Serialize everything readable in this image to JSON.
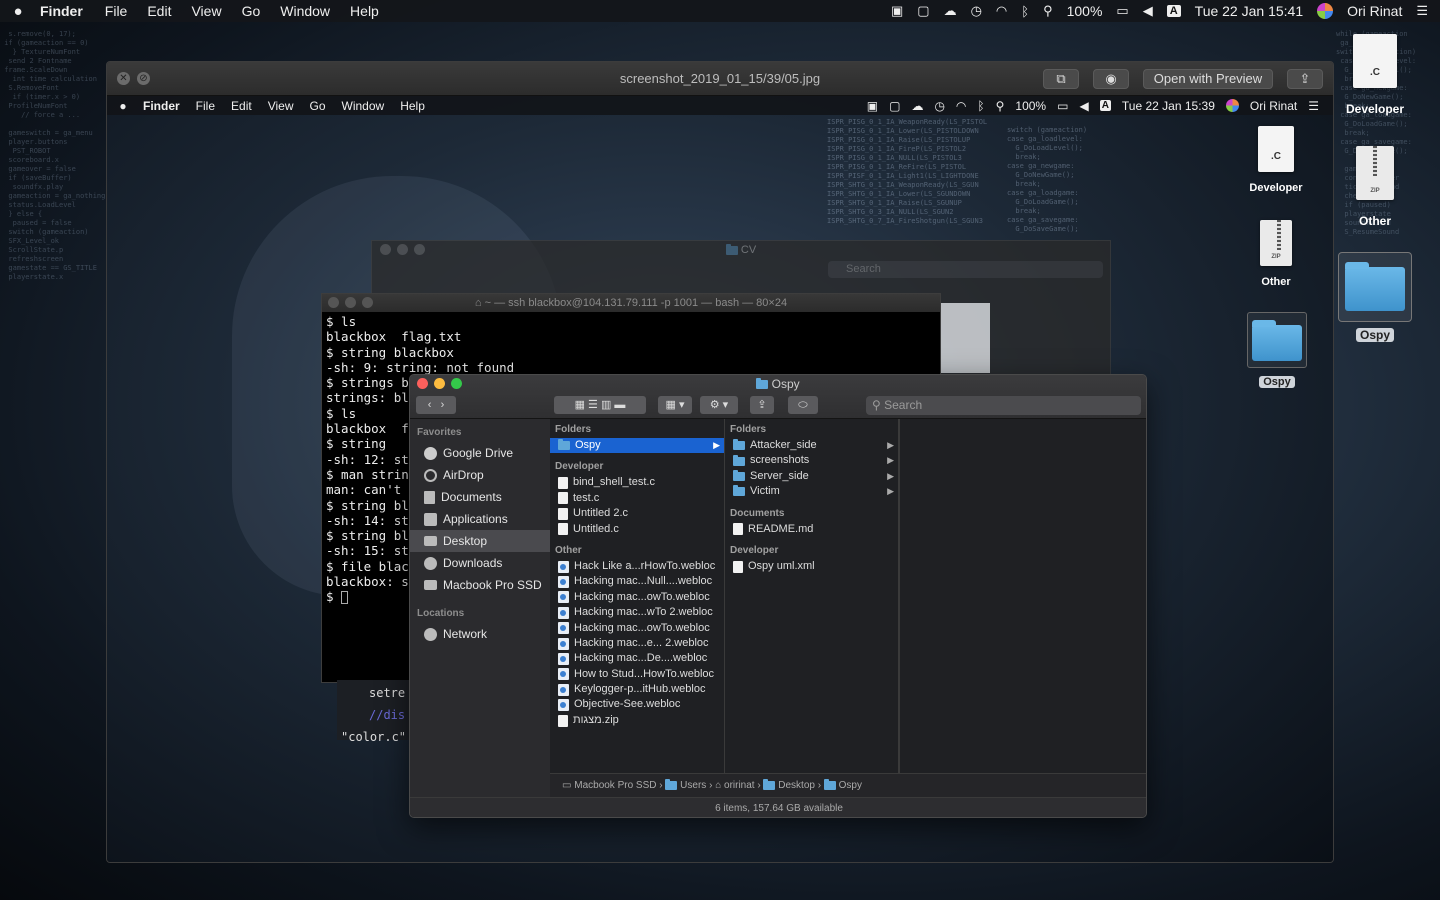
{
  "menubar": {
    "app": "Finder",
    "items": [
      "File",
      "Edit",
      "View",
      "Go",
      "Window",
      "Help"
    ],
    "battery": "100%",
    "input_source": "A",
    "datetime": "Tue 22 Jan 15:41",
    "user": "Ori Rinat"
  },
  "desktop": {
    "icons": [
      {
        "label": "Developer",
        "badge": ".C"
      },
      {
        "label": "Other",
        "badge": "ZIP"
      },
      {
        "label": "Ospy"
      }
    ]
  },
  "preview": {
    "filename": "screenshot_2019_01_15/39/05.jpg",
    "open_with_label": "Open with Preview"
  },
  "inner": {
    "app": "Finder",
    "items": [
      "File",
      "Edit",
      "View",
      "Go",
      "Window",
      "Help"
    ],
    "battery": "100%",
    "input_source": "A",
    "datetime": "Tue 22 Jan 15:39",
    "user": "Ori Rinat",
    "desktop_icons": [
      {
        "label": "Developer",
        "badge": ".C"
      },
      {
        "label": "Other",
        "badge": "ZIP"
      },
      {
        "label": "Ospy"
      }
    ],
    "cv_window": {
      "title": "CV",
      "search_placeholder": "Search"
    },
    "terminal": {
      "title": "~ — ssh blackbox@104.131.79.111 -p 1001 — bash — 80×24",
      "lines": [
        "$ ls",
        "blackbox  flag.txt",
        "$ string blackbox",
        "-sh: 9: string: not found",
        "$ strings b",
        "strings: bl",
        "$ ls",
        "blackbox  f",
        "$ string",
        "-sh: 12: st",
        "$ man strin",
        "man: can't",
        "$ string bl",
        "-sh: 14: st",
        "$ string bl",
        "-sh: 15: st",
        "$ file blac",
        "blackbox: s",
        "$ "
      ]
    },
    "code_snippet": [
      "setre",
      "//dis",
      "\"color.c\""
    ],
    "finder": {
      "title": "Ospy",
      "search_placeholder": "Search",
      "sidebar": {
        "favorites_header": "Favorites",
        "favorites": [
          "Google Drive",
          "AirDrop",
          "Documents",
          "Applications",
          "Desktop",
          "Downloads",
          "Macbook Pro SSD"
        ],
        "locations_header": "Locations",
        "locations": [
          "Network"
        ]
      },
      "col1": {
        "folders_header": "Folders",
        "folders": [
          "Ospy"
        ],
        "developer_header": "Developer",
        "developer": [
          "bind_shell_test.c",
          "test.c",
          "Untitled 2.c",
          "Untitled.c"
        ],
        "other_header": "Other",
        "other": [
          "Hack Like a...rHowTo.webloc",
          "Hacking mac...Null....webloc",
          "Hacking mac...owTo.webloc",
          "Hacking mac...wTo 2.webloc",
          "Hacking mac...owTo.webloc",
          "Hacking mac...e... 2.webloc",
          "Hacking mac...De....webloc",
          "How to Stud...HowTo.webloc",
          "Keylogger-p...itHub.webloc",
          "Objective-See.webloc",
          "מצגות.zip"
        ]
      },
      "col2": {
        "folders_header": "Folders",
        "folders": [
          "Attacker_side",
          "screenshots",
          "Server_side",
          "Victim"
        ],
        "documents_header": "Documents",
        "documents": [
          "README.md"
        ],
        "developer_header": "Developer",
        "developer": [
          "Ospy uml.xml"
        ]
      },
      "path": [
        "Macbook Pro SSD",
        "Users",
        "oririnat",
        "Desktop",
        "Ospy"
      ],
      "status": "6 items, 157.64 GB available"
    }
  }
}
